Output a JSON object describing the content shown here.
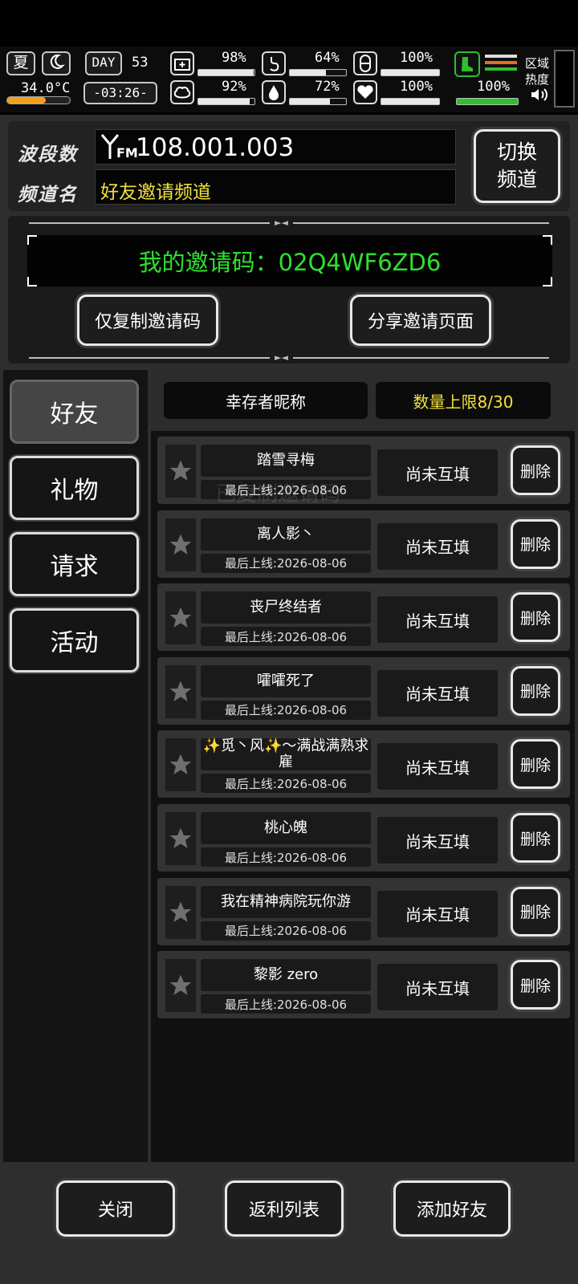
{
  "hud": {
    "season": "夏",
    "temperature": "34.0°C",
    "day_label": "DAY",
    "day_number": "53",
    "clock": "-03:26-",
    "stats": [
      {
        "name": "health",
        "value": "98%",
        "fill": 0.98
      },
      {
        "name": "stomach",
        "value": "64%",
        "fill": 0.64
      },
      {
        "name": "pill",
        "value": "100%",
        "fill": 1.0
      },
      {
        "name": "brain",
        "value": "92%",
        "fill": 0.92
      },
      {
        "name": "water",
        "value": "72%",
        "fill": 0.72
      },
      {
        "name": "heart",
        "value": "100%",
        "fill": 1.0
      }
    ],
    "stamina_value": "100%",
    "stamina_fill": 1.0,
    "zone_heat_label_line1": "区域",
    "zone_heat_label_line2": "热度"
  },
  "radio": {
    "band_label": "波段数",
    "band_value": "108.001.003",
    "fm_label": "FM",
    "channel_label": "频道名",
    "channel_value": "好友邀请频道",
    "switch_button_line1": "切换",
    "switch_button_line2": "频道"
  },
  "invite": {
    "code_text": "我的邀请码：02Q4WF6ZD6",
    "copy_button": "仅复制邀请码",
    "share_button": "分享邀请页面",
    "watermark": "已复制邀请码"
  },
  "tabs": [
    {
      "label": "好友",
      "active": true
    },
    {
      "label": "礼物",
      "active": false
    },
    {
      "label": "请求",
      "active": false
    },
    {
      "label": "活动",
      "active": false
    }
  ],
  "list_header": {
    "nickname_col": "幸存者昵称",
    "limit_text": "数量上限8/30"
  },
  "friends": [
    {
      "name": "踏雪寻梅",
      "last_online": "最后上线:2026-08-06",
      "status": "尚未互填",
      "delete": "删除"
    },
    {
      "name": "离人影丶",
      "last_online": "最后上线:2026-08-06",
      "status": "尚未互填",
      "delete": "删除"
    },
    {
      "name": "丧尸终结者",
      "last_online": "最后上线:2026-08-06",
      "status": "尚未互填",
      "delete": "删除"
    },
    {
      "name": "嚯嚯死了",
      "last_online": "最后上线:2026-08-06",
      "status": "尚未互填",
      "delete": "删除"
    },
    {
      "name": "✨觅丶风✨～满战满熟求雇",
      "last_online": "最后上线:2026-08-06",
      "status": "尚未互填",
      "delete": "删除"
    },
    {
      "name": "桃心魄",
      "last_online": "最后上线:2026-08-06",
      "status": "尚未互填",
      "delete": "删除"
    },
    {
      "name": "我在精神病院玩你游",
      "last_online": "最后上线:2026-08-06",
      "status": "尚未互填",
      "delete": "删除"
    },
    {
      "name": "黎影 zero",
      "last_online": "最后上线:2026-08-06",
      "status": "尚未互填",
      "delete": "删除"
    }
  ],
  "footer": {
    "close_button": "关闭",
    "rebate_button": "返利列表",
    "add_friend_button": "添加好友"
  },
  "colors": {
    "invite_code": "#2ee02e",
    "channel_name": "#f2e13c",
    "limit_text": "#f2e13c"
  }
}
